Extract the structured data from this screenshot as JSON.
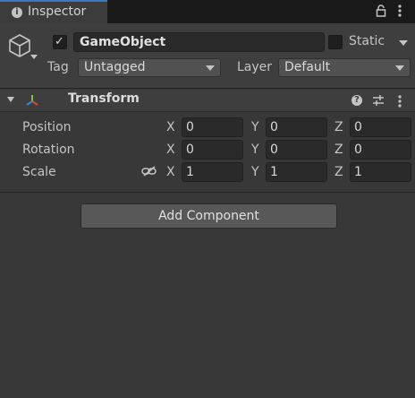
{
  "tab": {
    "title": "Inspector",
    "info_glyph": "i"
  },
  "gameobject": {
    "name": "GameObject",
    "active": true,
    "static_label": "Static",
    "static": false,
    "tag_label": "Tag",
    "tag_value": "Untagged",
    "layer_label": "Layer",
    "layer_value": "Default"
  },
  "transform": {
    "title": "Transform",
    "help_glyph": "?",
    "axes": {
      "x": "X",
      "y": "Y",
      "z": "Z"
    },
    "position": {
      "label": "Position",
      "x": "0",
      "y": "0",
      "z": "0"
    },
    "rotation": {
      "label": "Rotation",
      "x": "0",
      "y": "0",
      "z": "0"
    },
    "scale": {
      "label": "Scale",
      "x": "1",
      "y": "1",
      "z": "1"
    }
  },
  "add_component_label": "Add Component",
  "colors": {
    "accent": "#3a79bb",
    "transform_x": "#d64a3a",
    "transform_y": "#7fc24a",
    "transform_z": "#3a86d6"
  }
}
